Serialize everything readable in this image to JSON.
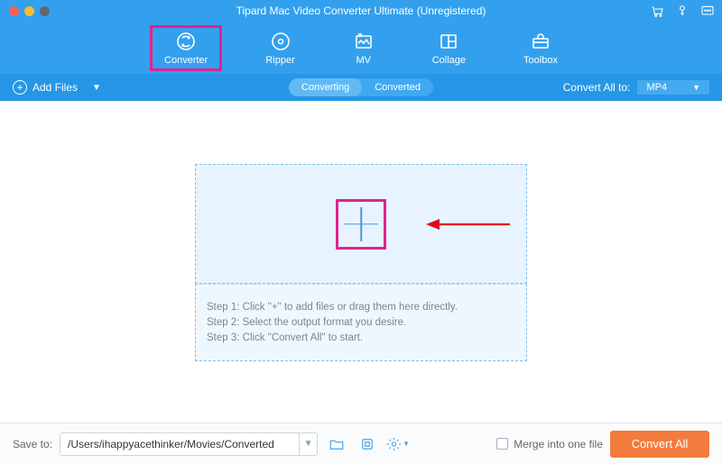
{
  "window": {
    "title": "Tipard Mac Video Converter Ultimate (Unregistered)"
  },
  "nav": {
    "items": [
      {
        "label": "Converter"
      },
      {
        "label": "Ripper"
      },
      {
        "label": "MV"
      },
      {
        "label": "Collage"
      },
      {
        "label": "Toolbox"
      }
    ]
  },
  "toolbar": {
    "add_files_label": "Add Files",
    "tab_converting": "Converting",
    "tab_converted": "Converted",
    "convert_all_to_label": "Convert All to:",
    "selected_format": "MP4"
  },
  "steps": {
    "s1": "Step 1: Click \"+\" to add files or drag them here directly.",
    "s2": "Step 2: Select the output format you desire.",
    "s3": "Step 3: Click \"Convert All\" to start."
  },
  "footer": {
    "save_to_label": "Save to:",
    "save_path": "/Users/ihappyacethinker/Movies/Converted",
    "merge_label": "Merge into one file",
    "convert_all_btn": "Convert All"
  }
}
